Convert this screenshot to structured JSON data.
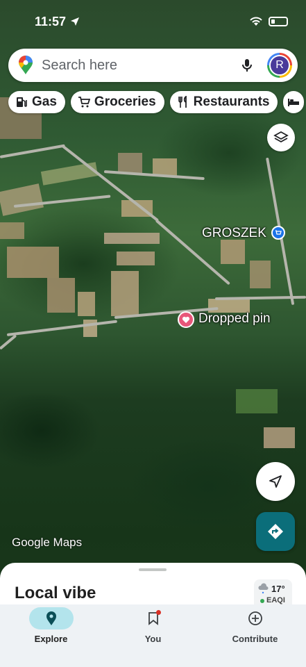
{
  "status_bar": {
    "time": "11:57"
  },
  "search": {
    "placeholder": "Search here",
    "avatar_initial": "R"
  },
  "chips": [
    {
      "label": "Gas",
      "icon": "gas-station-icon"
    },
    {
      "label": "Groceries",
      "icon": "cart-icon"
    },
    {
      "label": "Restaurants",
      "icon": "fork-knife-icon"
    }
  ],
  "map": {
    "places": [
      {
        "label": "GROSZEK",
        "icon": "shopping-icon"
      },
      {
        "label": "Dropped pin",
        "icon": "heart-pin-icon"
      }
    ],
    "attribution": "Google Maps"
  },
  "bottom_sheet": {
    "title": "Local vibe",
    "weather": {
      "temperature": "17°",
      "air_quality": "EAQI"
    }
  },
  "nav": [
    {
      "label": "Explore",
      "icon": "location-pin-icon",
      "active": true
    },
    {
      "label": "You",
      "icon": "bookmark-icon",
      "active": false
    },
    {
      "label": "Contribute",
      "icon": "plus-circle-icon",
      "active": false
    }
  ],
  "colors": {
    "accent": "#0b6e7a",
    "active_tab_bg": "#b3e4ec",
    "pin": "#e8577a",
    "shop_pin": "#1a73e8"
  }
}
